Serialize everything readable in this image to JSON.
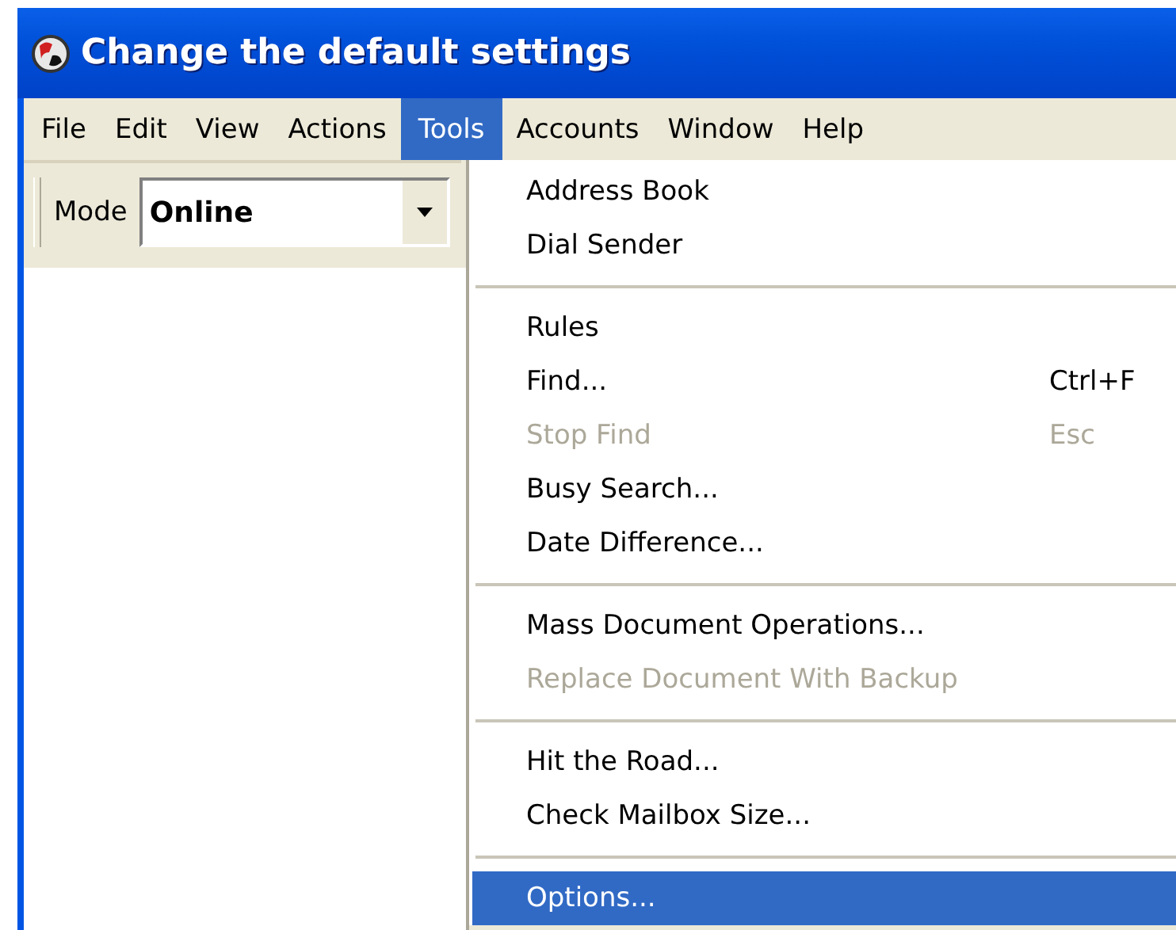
{
  "window": {
    "title": "Change the default settings"
  },
  "menu_bar": [
    {
      "label": "File",
      "selected": false
    },
    {
      "label": "Edit",
      "selected": false
    },
    {
      "label": "View",
      "selected": false
    },
    {
      "label": "Actions",
      "selected": false
    },
    {
      "label": "Tools",
      "selected": true
    },
    {
      "label": "Accounts",
      "selected": false
    },
    {
      "label": "Window",
      "selected": false
    },
    {
      "label": "Help",
      "selected": false
    }
  ],
  "toolbar": {
    "mode_label": "Mode",
    "mode_value": "Online"
  },
  "menu": [
    {
      "kind": "item",
      "label": "Address Book",
      "disabled": false,
      "selected": false
    },
    {
      "kind": "item",
      "label": "Dial Sender",
      "disabled": false,
      "selected": false
    },
    {
      "kind": "separator"
    },
    {
      "kind": "item",
      "label": "Rules",
      "disabled": false,
      "selected": false
    },
    {
      "kind": "item",
      "label": "Find...",
      "shortcut": "Ctrl+F",
      "disabled": false,
      "selected": false
    },
    {
      "kind": "item",
      "label": "Stop Find",
      "shortcut": "Esc",
      "disabled": true,
      "selected": false
    },
    {
      "kind": "item",
      "label": "Busy Search...",
      "disabled": false,
      "selected": false
    },
    {
      "kind": "item",
      "label": "Date Difference...",
      "disabled": false,
      "selected": false
    },
    {
      "kind": "separator"
    },
    {
      "kind": "item",
      "label": "Mass Document Operations...",
      "disabled": false,
      "selected": false
    },
    {
      "kind": "item",
      "label": "Replace Document With Backup",
      "disabled": true,
      "selected": false
    },
    {
      "kind": "separator"
    },
    {
      "kind": "item",
      "label": "Hit the Road...",
      "disabled": false,
      "selected": false
    },
    {
      "kind": "item",
      "label": "Check Mailbox Size...",
      "disabled": false,
      "selected": false
    },
    {
      "kind": "separator"
    },
    {
      "kind": "item",
      "label": "Options...",
      "disabled": false,
      "selected": true
    }
  ]
}
